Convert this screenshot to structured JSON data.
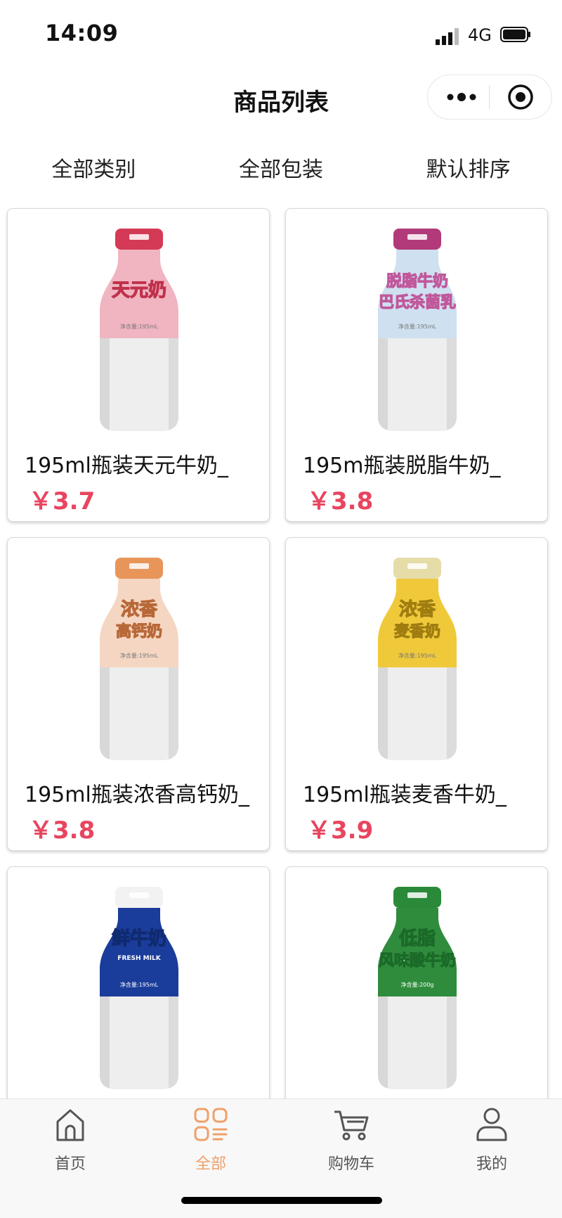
{
  "status": {
    "time": "14:09",
    "network": "4G"
  },
  "nav": {
    "title": "商品列表"
  },
  "filters": [
    {
      "label": "全部类别"
    },
    {
      "label": "全部包装"
    },
    {
      "label": "默认排序"
    }
  ],
  "products": [
    {
      "name": "195ml瓶装天元牛奶_",
      "price": "￥3.7",
      "label_main": "天元奶",
      "label_sub": "",
      "net": "净含量:195mL",
      "cap_color": "#d43a55",
      "label_color": "#f1b4c1",
      "text_color": "#ffffff",
      "stroke_color": "#c0314b"
    },
    {
      "name": "195m瓶装脱脂牛奶_",
      "price": "￥3.8",
      "label_main": "脱脂牛奶",
      "label_sub": "巴氏杀菌乳",
      "net": "净含量:195mL",
      "cap_color": "#b23a7a",
      "label_color": "#cfe0f0",
      "text_color": "#ffffff",
      "stroke_color": "#c0589b"
    },
    {
      "name": "195ml瓶装浓香高钙奶_",
      "price": "￥3.8",
      "label_main": "浓香",
      "label_sub": "高钙奶",
      "net": "净含量:195mL",
      "cap_color": "#e8955a",
      "label_color": "#f5d6c2",
      "text_color": "#ffffff",
      "stroke_color": "#b86838"
    },
    {
      "name": "195ml瓶装麦香牛奶_",
      "price": "￥3.9",
      "label_main": "浓香",
      "label_sub": "麦香奶",
      "net": "净含量:195mL",
      "cap_color": "#e6dca8",
      "label_color": "#f0c93a",
      "text_color": "#ffffff",
      "stroke_color": "#a07d10"
    },
    {
      "name": "",
      "price": "",
      "label_main": "鲜牛奶",
      "label_sub": "FRESH MILK",
      "net": "净含量:195mL",
      "cap_color": "#f2f2f2",
      "label_color": "#1a3c9a",
      "text_color": "#ffffff",
      "stroke_color": "#102a70"
    },
    {
      "name": "",
      "price": "",
      "label_main": "低脂",
      "label_sub": "风味酸牛奶",
      "net": "净含量:200g",
      "cap_color": "#2a8a3a",
      "label_color": "#2f8c3c",
      "text_color": "#ffffff",
      "stroke_color": "#1b6a28"
    }
  ],
  "tabs": [
    {
      "label": "首页",
      "icon": "home-icon",
      "active": false
    },
    {
      "label": "全部",
      "icon": "grid-list-icon",
      "active": true
    },
    {
      "label": "购物车",
      "icon": "cart-icon",
      "active": false
    },
    {
      "label": "我的",
      "icon": "user-icon",
      "active": false
    }
  ],
  "colors": {
    "price": "#e8455f",
    "active_tab": "#f0a06a"
  }
}
